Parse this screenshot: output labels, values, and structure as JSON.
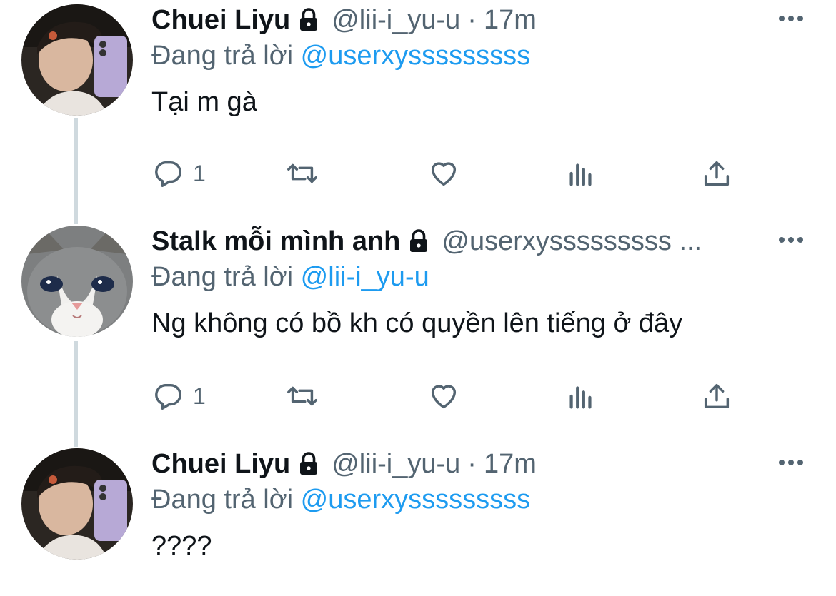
{
  "tweets": [
    {
      "name": "Chuei Liyu",
      "handle": "@lii-i_yu-u",
      "time": "17m",
      "replying_prefix": "Đang trả lời",
      "replying_to": "@userxysssssssss",
      "text": "Tại m gà",
      "reply_count": "1",
      "avatar": "avatar-boy"
    },
    {
      "name": "Stalk mỗi mình anh",
      "handle": "@userxysssssssss ...",
      "time": "",
      "replying_prefix": "Đang trả lời",
      "replying_to": "@lii-i_yu-u",
      "text": "Ng không có bồ kh có quyền lên tiếng ở đây",
      "reply_count": "1",
      "avatar": "avatar-cat"
    },
    {
      "name": "Chuei Liyu",
      "handle": "@lii-i_yu-u",
      "time": "17m",
      "replying_prefix": "Đang trả lời",
      "replying_to": "@userxysssssssss",
      "text": "????",
      "reply_count": "",
      "avatar": "avatar-boy"
    }
  ],
  "separator": "·",
  "colors": {
    "link": "#1d9bf0",
    "muted": "#536471",
    "text": "#0f1419",
    "thread_line": "#cfd9de"
  },
  "icons": [
    "lock-icon",
    "more-icon",
    "reply-icon",
    "retweet-icon",
    "like-icon",
    "views-icon",
    "share-icon"
  ]
}
